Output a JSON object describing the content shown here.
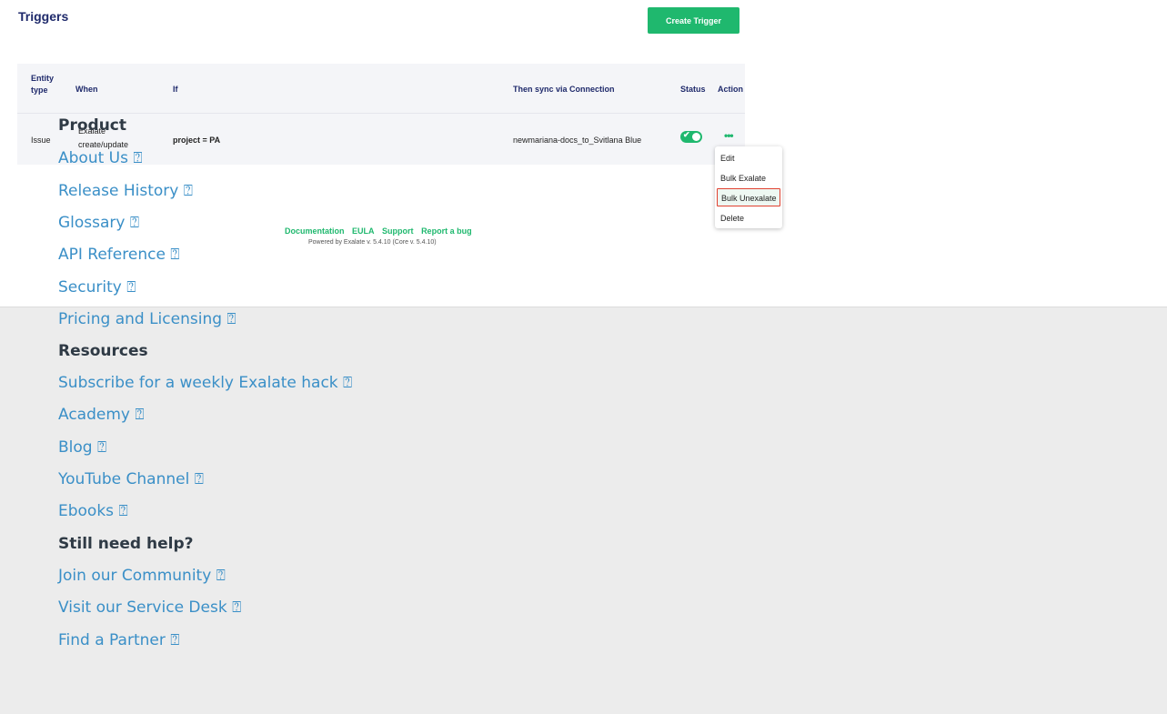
{
  "header": {
    "title": "Triggers",
    "create_button": "Create Trigger"
  },
  "table": {
    "headers": [
      "Entity type",
      "When",
      "If",
      "Then sync via Connection",
      "Status",
      "Action"
    ],
    "row": {
      "entity_type": "Issue",
      "when_line1": "Exalate",
      "when_line2": "create/update",
      "if": "project = PA",
      "connection": "newmariana-docs_to_Svitlana Blue",
      "status": "enabled"
    }
  },
  "action_menu": {
    "items": [
      "Edit",
      "Bulk Exalate",
      "Bulk Unexalate",
      "Delete"
    ],
    "selected_index": 2
  },
  "footer": {
    "links": [
      "Documentation",
      "EULA",
      "Support",
      "Report a bug"
    ],
    "powered_by": "Powered by Exalate v. 5.4.10 (Core v. 5.4.10)"
  },
  "overlay": {
    "product_heading": "Product",
    "product_links": [
      "About Us ⍰",
      "Release History ⍰",
      "Glossary ⍰",
      "API Reference ⍰",
      "Security ⍰",
      "Pricing and Licensing ⍰"
    ],
    "resources_heading": "Resources",
    "resources_links": [
      "Subscribe for a weekly Exalate hack ⍰",
      "Academy ⍰",
      "Blog ⍰",
      "YouTube Channel ⍰",
      "Ebooks ⍰"
    ],
    "help_heading": "Still need help?",
    "help_links": [
      "Join our Community ⍰",
      "Visit our Service Desk ⍰",
      "Find a Partner ⍰"
    ]
  },
  "colors": {
    "accent": "#1fb86e",
    "title": "#1f2a6b",
    "link": "#3a8fc7",
    "highlight_border": "#e0402f"
  }
}
